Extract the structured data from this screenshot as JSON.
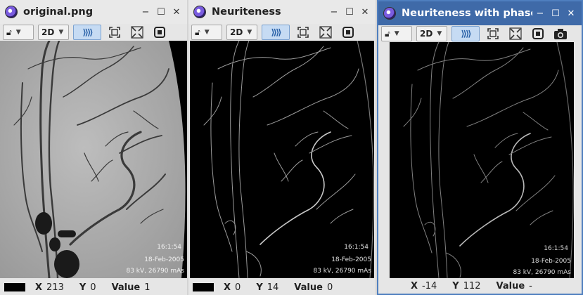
{
  "windows": [
    {
      "title": "original.png",
      "toolbar": {
        "dim_label": "2D",
        "link_label": "⟫⟫"
      },
      "status": {
        "x_label": "X",
        "x_value": "213",
        "y_label": "Y",
        "y_value": "0",
        "value_label": "Value",
        "value_value": "1"
      },
      "image": {
        "style": "angiogram",
        "annotations": [
          "16:1:54",
          "18-Feb-2005",
          "83 kV, 26790 mAs"
        ]
      }
    },
    {
      "title": "Neuriteness",
      "toolbar": {
        "dim_label": "2D",
        "link_label": "⟫⟫"
      },
      "status": {
        "x_label": "X",
        "x_value": "0",
        "y_label": "Y",
        "y_value": "14",
        "value_label": "Value",
        "value_value": "0"
      },
      "image": {
        "style": "filtered",
        "annotations": [
          "16:1:54",
          "18-Feb-2005",
          "83 kV, 26790 mAs"
        ]
      }
    },
    {
      "title": "Neuriteness with phase",
      "toolbar": {
        "dim_label": "2D",
        "link_label": "⟫⟫"
      },
      "status": {
        "x_label": "X",
        "x_value": "-14",
        "y_label": "Y",
        "y_value": "112",
        "value_label": "Value",
        "value_value": "-"
      },
      "image": {
        "style": "filtered",
        "annotations": [
          "16:1:54",
          "18-Feb-2005",
          "83 kV, 26790 mAs"
        ]
      }
    }
  ],
  "window_buttons": {
    "minimize": "−",
    "maximize": "☐",
    "close": "✕"
  },
  "colors": {
    "active_title": "#3f6aa8",
    "link_button": "#c6dbf3"
  }
}
